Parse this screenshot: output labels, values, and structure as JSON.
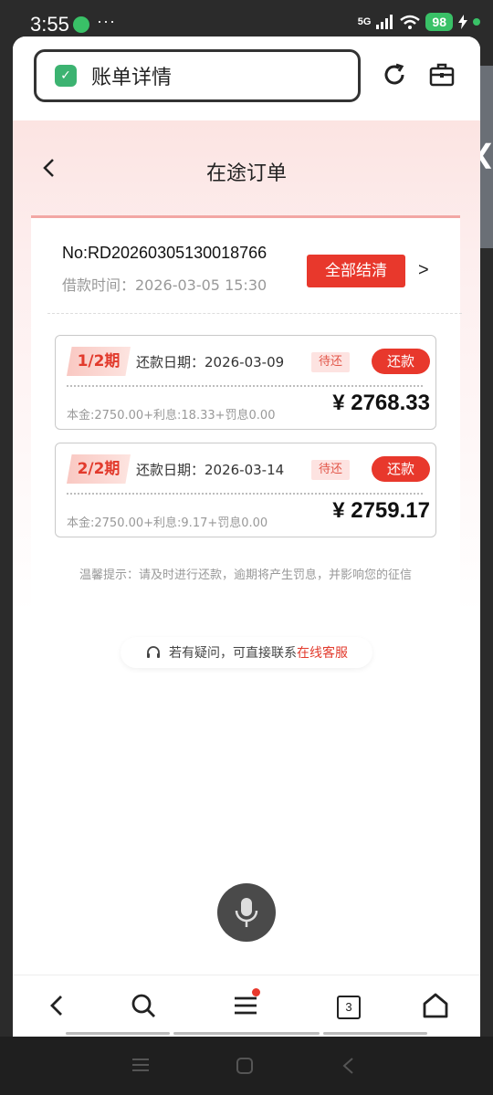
{
  "status_bar": {
    "time": "3:55",
    "dots": "···",
    "network": "5G",
    "battery": "98"
  },
  "browser": {
    "address_text": "账单详情",
    "tab_count": "3"
  },
  "page": {
    "title": "在途订单",
    "order": {
      "number": "No:RD20260305130018766",
      "loan_time": "借款时间：2026-03-05 15:30",
      "settle_all_label": "全部结清",
      "chevron": ">"
    },
    "installments": [
      {
        "period": "1/2期",
        "due_date": "还款日期：2026-03-09",
        "status": "待还",
        "action": "还款",
        "breakdown": "本金:2750.00+利息:18.33+罚息0.00",
        "amount": "¥ 2768.33"
      },
      {
        "period": "2/2期",
        "due_date": "还款日期：2026-03-14",
        "status": "待还",
        "action": "还款",
        "breakdown": "本金:2750.00+利息:9.17+罚息0.00",
        "amount": "¥ 2759.17"
      }
    ],
    "tip": "温馨提示：请及时进行还款，逾期将产生罚息，并影响您的征信",
    "contact_prefix": "若有疑问，可直接联系",
    "contact_link": "在线客服"
  },
  "colors": {
    "accent": "#e8382c",
    "shield": "#3cb371",
    "battery": "#39c167"
  },
  "icons": [
    "shield-check-icon",
    "refresh-icon",
    "toolbox-icon",
    "back-arrow-icon",
    "headset-icon",
    "microphone-icon",
    "search-icon",
    "menu-icon",
    "home-icon"
  ]
}
